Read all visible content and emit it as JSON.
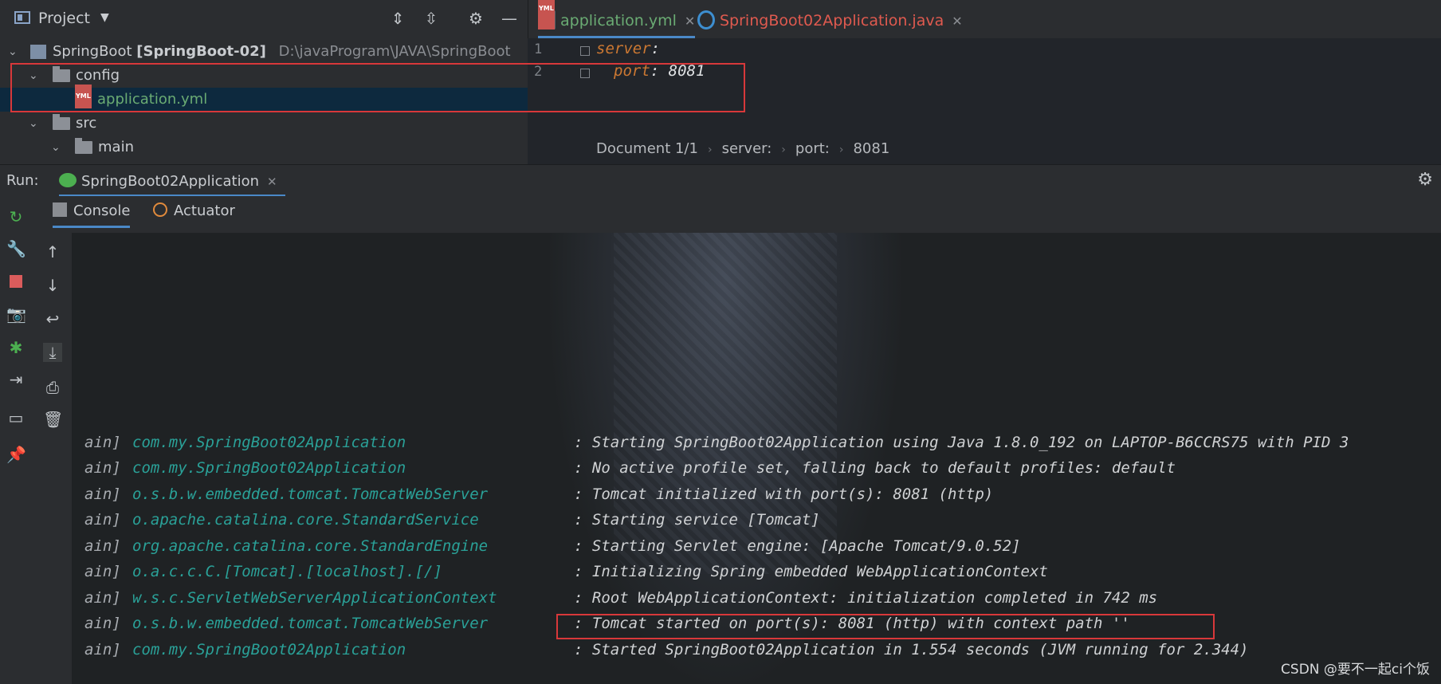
{
  "toolbar": {
    "project_label": "Project"
  },
  "tabs": [
    {
      "label": "application.yml",
      "color": "#6aab73"
    },
    {
      "label": "SpringBoot02Application.java",
      "color": "#e05a4f"
    }
  ],
  "tree": {
    "root_name": "SpringBoot",
    "root_module": "[SpringBoot-02]",
    "root_path": "D:\\javaProgram\\JAVA\\SpringBoot",
    "items": [
      {
        "label": "config"
      },
      {
        "label": "application.yml"
      },
      {
        "label": "src"
      },
      {
        "label": "main"
      }
    ]
  },
  "editor": {
    "lines": [
      {
        "num": "1",
        "key": "server",
        "value": ""
      },
      {
        "num": "2",
        "key": "port",
        "value": "8081"
      }
    ],
    "breadcrumbs": [
      "Document 1/1",
      "server:",
      "port:",
      "8081"
    ]
  },
  "run": {
    "label": "Run:",
    "config": "SpringBoot02Application",
    "subtabs": [
      "Console",
      "Actuator"
    ]
  },
  "console": {
    "lines": [
      {
        "prefix": "ain]",
        "cls": "com.my.SpringBoot02Application",
        "msg": ": Starting SpringBoot02Application using Java 1.8.0_192 on LAPTOP-B6CCRS75 with PID 3"
      },
      {
        "prefix": "ain]",
        "cls": "com.my.SpringBoot02Application",
        "msg": ": No active profile set, falling back to default profiles: default"
      },
      {
        "prefix": "ain]",
        "cls": "o.s.b.w.embedded.tomcat.TomcatWebServer",
        "msg": ": Tomcat initialized with port(s): 8081 (http)"
      },
      {
        "prefix": "ain]",
        "cls": "o.apache.catalina.core.StandardService",
        "msg": ": Starting service [Tomcat]"
      },
      {
        "prefix": "ain]",
        "cls": "org.apache.catalina.core.StandardEngine",
        "msg": ": Starting Servlet engine: [Apache Tomcat/9.0.52]"
      },
      {
        "prefix": "ain]",
        "cls": "o.a.c.c.C.[Tomcat].[localhost].[/]",
        "msg": ": Initializing Spring embedded WebApplicationContext"
      },
      {
        "prefix": "ain]",
        "cls": "w.s.c.ServletWebServerApplicationContext",
        "msg": ": Root WebApplicationContext: initialization completed in 742 ms"
      },
      {
        "prefix": "ain]",
        "cls": "o.s.b.w.embedded.tomcat.TomcatWebServer",
        "msg": ": Tomcat started on port(s): 8081 (http) with context path ''"
      },
      {
        "prefix": "ain]",
        "cls": "com.my.SpringBoot02Application",
        "msg": ": Started SpringBoot02Application in 1.554 seconds (JVM running for 2.344)"
      }
    ]
  },
  "watermark": "CSDN @要不一起ci个饭"
}
